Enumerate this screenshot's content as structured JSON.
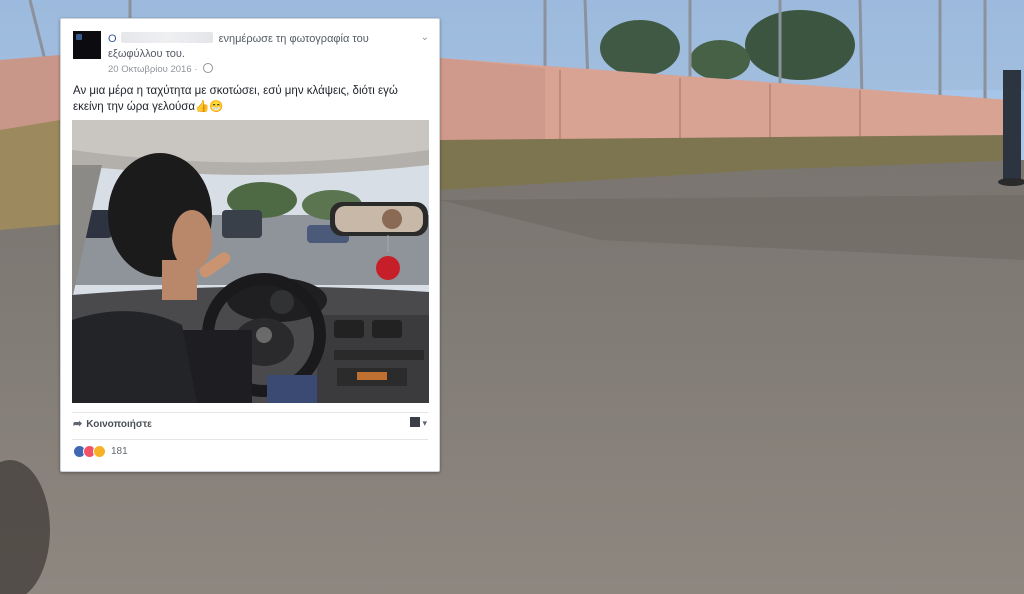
{
  "post": {
    "name_prefix": "Ο",
    "action_text": "ενημέρωσε τη φωτογραφία του εξωφύλλου του.",
    "date": "20 Οκτωβρίου 2016 ·",
    "text": "Αν μια μέρα η ταχύτητα με σκοτώσει, εσύ μην κλάψεις, διότι εγώ εκείνη την ώρα γελούσα👍😁",
    "share_label": "Κοινοποιήστε",
    "reactions_count": "181"
  },
  "icons": {
    "audience": "globe-icon",
    "menu": "chevron-down-icon",
    "share": "share-arrow-icon",
    "reactions": [
      "like-reaction-icon",
      "love-reaction-icon",
      "haha-reaction-icon"
    ],
    "viewer": "viewer-avatar-icon"
  },
  "colors": {
    "link_blue": "#385898",
    "text_dark": "#1d2129",
    "meta_gray": "#90949c",
    "like": "#4267b2",
    "love": "#f25268",
    "haha": "#f7b125"
  }
}
